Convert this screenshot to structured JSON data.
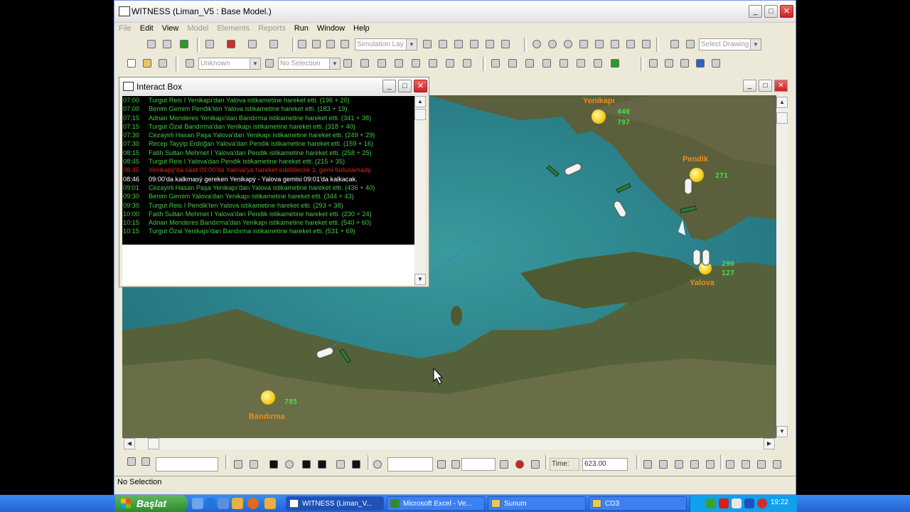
{
  "window": {
    "title": "WITNESS (Liman_V5 : Base Model.)",
    "controls": {
      "minimize": "_",
      "maximize": "□",
      "close": "✕"
    }
  },
  "menu": [
    "File",
    "Edit",
    "View",
    "Model",
    "Elements",
    "Reports",
    "Run",
    "Window",
    "Help"
  ],
  "menu_disabled": [
    "File",
    "Model",
    "Elements",
    "Reports"
  ],
  "toolbar1": {
    "layout_combo": "Simulation Lay",
    "drawing_combo": "Select Drawing"
  },
  "toolbar2": {
    "type_combo": "Unknown",
    "selection_combo": "No Selection"
  },
  "interact_box": {
    "title": "Interact Box",
    "log": [
      {
        "time": "07:00",
        "text": "Turgut Reis I Yenikapı'dan Yalova istikametine hareket etti. (196 + 20)",
        "color": "#46c846"
      },
      {
        "time": "07:00",
        "text": "Benim Gemim Pendik'ten Yalova istikametine hareket etti. (183 + 19)",
        "color": "#46c846"
      },
      {
        "time": "07:15",
        "text": "Adnan Menderes Yenikapı'dan Bandırma istikametine hareket etti. (341 + 38)",
        "color": "#46c846"
      },
      {
        "time": "07:15",
        "text": "Turgut Özal Bandırma'dan Yenikapı istikametine hareket etti. (318 + 40)",
        "color": "#46c846"
      },
      {
        "time": "07:30",
        "text": "Cezayirli Hasan Paşa Yalova'dan Yenikapı istikametine hareket etti. (249 + 29)",
        "color": "#46c846"
      },
      {
        "time": "07:30",
        "text": "Recep Tayyip Erdoğan Yalova'dan Pendik istikametine hareket etti. (159 + 16)",
        "color": "#46c846"
      },
      {
        "time": "08:15",
        "text": "Fatih Sultan Mehmet I Yalova'dan Pendik istikametine hareket etti. (258 + 25)",
        "color": "#46c846"
      },
      {
        "time": "08:45",
        "text": "Turgut Reis I Yalova'dan Pendik istikametine hareket etti. (215 + 35)",
        "color": "#46c846"
      },
      {
        "time": "08:45",
        "text": "Yenikapý'da saat 09:00'da Yalova'ya hareket edebilecek 1. gemi bulunamadý.",
        "color": "#e02020"
      },
      {
        "time": "08:46",
        "text": "09:00'da kalkmasý gereken Yenikapý - Yalova gemisi 09:01'da kalkacak.",
        "color": "#ffffff"
      },
      {
        "time": "09:01",
        "text": "Cezayirli Hasan Paşa Yenikapı'dan Yalova istikametine hareket etti. (436 + 40)",
        "color": "#46c846"
      },
      {
        "time": "09:30",
        "text": "Benim Gemim Yalova'dan Yenikapı istikametine hareket etti. (344 + 43)",
        "color": "#46c846"
      },
      {
        "time": "09:30",
        "text": "Turgut Reis I Pendik'ten Yalova istikametine hareket etti. (293 + 38)",
        "color": "#46c846"
      },
      {
        "time": "10:00",
        "text": "Fatih Sultan Mehmet I Yalova'dan Pendik istikametine hareket etti. (230 + 24)",
        "color": "#46c846"
      },
      {
        "time": "10:15",
        "text": "Adnan Menderes Bandırma'dan Yenikapı istikametine hareket etti. (540 + 60)",
        "color": "#46c846"
      },
      {
        "time": "10:15",
        "text": "Turgut Özal Yenikapı'dan Bandırma istikametine hareket etti. (531 + 69)",
        "color": "#46c846"
      }
    ]
  },
  "map": {
    "ports": {
      "yenikapi": {
        "name": "Yenikapı",
        "count_a": "446",
        "count_b": "797"
      },
      "pendik": {
        "name": "Pendik",
        "count_a": "271"
      },
      "yalova": {
        "name": "Yalova",
        "count_a": "290",
        "count_b": "127"
      },
      "bandirma": {
        "name": "Bandırma",
        "count_a": "785"
      }
    }
  },
  "run_controls": {
    "time_label": "Time:",
    "time_value": "623.00"
  },
  "status": {
    "text": "No Selection"
  },
  "taskbar": {
    "start": "Başlat",
    "buttons": [
      "WITNESS (Liman_V...",
      "Microsoft Excel - Ve...",
      "Sunum",
      "CD3"
    ],
    "clock": "19:22"
  },
  "colors": {
    "port_label": "#f08a1c",
    "count": "#46e046",
    "sea": "#2a7f86",
    "land": "#4f5a32"
  }
}
